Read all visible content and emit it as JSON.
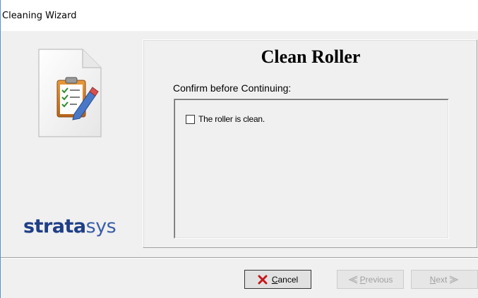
{
  "window": {
    "title": "Cleaning Wizard"
  },
  "sidebar": {
    "icon": "clipboard-document-icon",
    "logo_bold": "strata",
    "logo_light": "sys"
  },
  "content": {
    "heading": "Clean Roller",
    "confirm_label": "Confirm before Continuing:",
    "checkbox": {
      "label": "The roller is clean.",
      "checked": false
    }
  },
  "buttons": {
    "cancel": {
      "underline": "C",
      "rest": "ancel",
      "icon": "red-x-icon",
      "enabled": true
    },
    "previous": {
      "underline": "P",
      "rest": "revious",
      "icon": "left-arrow-icon",
      "enabled": false
    },
    "next": {
      "underline": "N",
      "rest": "ext",
      "icon": "right-arrow-icon",
      "enabled": false
    }
  },
  "colors": {
    "logo": "#1f3f86",
    "cancel_x": "#c8161d",
    "disabled_text": "#a0a0a0"
  }
}
